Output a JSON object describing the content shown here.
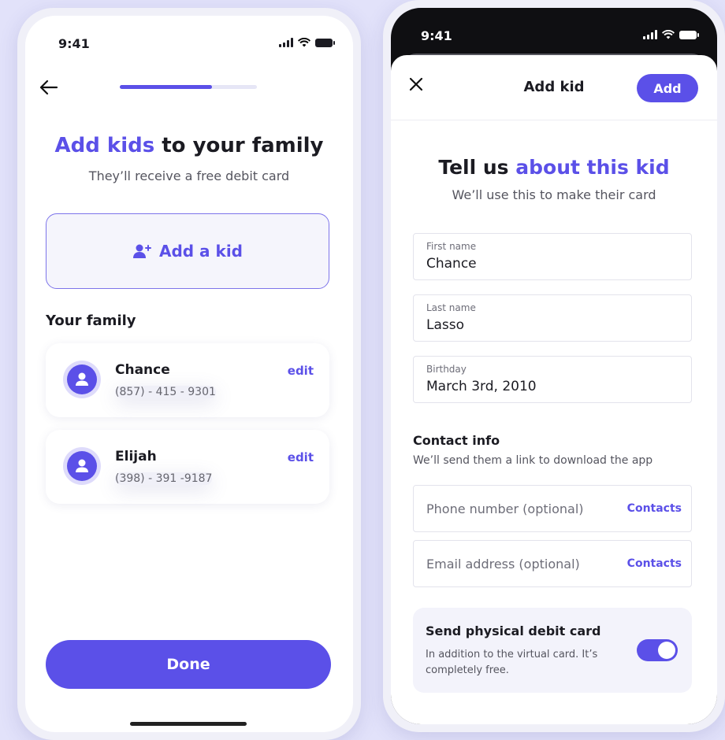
{
  "colors": {
    "accent": "#5b50e8",
    "background": "#e2e2fa"
  },
  "screen1": {
    "status_time": "9:41",
    "progress_fraction": 0.67,
    "title_accent": "Add kids",
    "title_rest": " to your family",
    "subtitle": "They’ll receive a free debit card",
    "add_kid_label": "Add a kid",
    "family_heading": "Your family",
    "members": [
      {
        "name": "Chance",
        "phone": "(857) - 415 - 9301",
        "edit_label": "edit"
      },
      {
        "name": "Elijah",
        "phone": "(398) - 391 -9187",
        "edit_label": "edit"
      }
    ],
    "done_label": "Done"
  },
  "screen2": {
    "status_time": "9:41",
    "sheet_title": "Add kid",
    "add_button": "Add",
    "heading_plain": "Tell us ",
    "heading_accent": "about this kid",
    "subheading": "We’ll use this to make their card",
    "fields": {
      "first_name": {
        "label": "First name",
        "value": "Chance"
      },
      "last_name": {
        "label": "Last name",
        "value": "Lasso"
      },
      "birthday": {
        "label": "Birthday",
        "value": "March 3rd, 2010"
      }
    },
    "contact_heading": "Contact info",
    "contact_sub": "We’ll send them a link to download the app",
    "phone_placeholder": "Phone number (optional)",
    "email_placeholder": "Email address (optional)",
    "contacts_label": "Contacts",
    "physical_card_title": "Send physical debit card",
    "physical_card_desc": "In addition to the virtual card. It’s completely free.",
    "physical_card_enabled": true
  }
}
